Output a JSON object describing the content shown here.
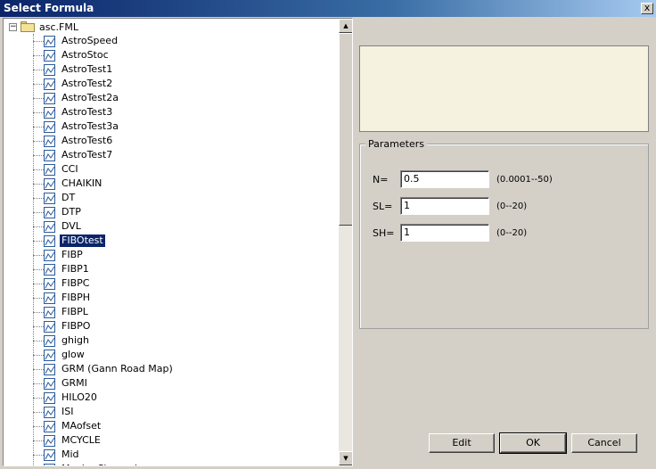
{
  "window": {
    "title": "Select Formula",
    "close_glyph": "x"
  },
  "tree": {
    "root_label": "asc.FML",
    "expander_glyph": "−",
    "items": [
      {
        "label": "AstroSpeed"
      },
      {
        "label": "AstroStoc"
      },
      {
        "label": "AstroTest1"
      },
      {
        "label": "AstroTest2"
      },
      {
        "label": "AstroTest2a"
      },
      {
        "label": "AstroTest3"
      },
      {
        "label": "AstroTest3a"
      },
      {
        "label": "AstroTest6"
      },
      {
        "label": "AstroTest7"
      },
      {
        "label": "CCI"
      },
      {
        "label": "CHAIKIN"
      },
      {
        "label": "DT"
      },
      {
        "label": "DTP"
      },
      {
        "label": "DVL"
      },
      {
        "label": "FIBOtest",
        "selected": true
      },
      {
        "label": "FIBP"
      },
      {
        "label": "FIBP1"
      },
      {
        "label": "FIBPC"
      },
      {
        "label": "FIBPH"
      },
      {
        "label": "FIBPL"
      },
      {
        "label": "FIBPO"
      },
      {
        "label": "ghigh"
      },
      {
        "label": "glow"
      },
      {
        "label": "GRM (Gann Road Map)"
      },
      {
        "label": "GRMI"
      },
      {
        "label": "HILO20"
      },
      {
        "label": "ISI"
      },
      {
        "label": "MAofset"
      },
      {
        "label": "MCYCLE"
      },
      {
        "label": "Mid"
      },
      {
        "label": "MovingChannel"
      }
    ],
    "icon": "formula-chart-icon",
    "selected_color": "#0a246a"
  },
  "scrollbar": {
    "up_glyph": "▲",
    "down_glyph": "▼"
  },
  "parameters": {
    "title": "Parameters",
    "rows": [
      {
        "label": "N=",
        "value": "0.5",
        "range": "(0.0001--50)"
      },
      {
        "label": "SL=",
        "value": "1",
        "range": "(0--20)"
      },
      {
        "label": "SH=",
        "value": "1",
        "range": "(0--20)"
      }
    ]
  },
  "buttons": {
    "edit": "Edit",
    "ok": "OK",
    "cancel": "Cancel"
  },
  "colors": {
    "titlebar": "#0a246a",
    "preview_bg": "#f5f3df",
    "dialog_bg": "#d4d0c8"
  }
}
